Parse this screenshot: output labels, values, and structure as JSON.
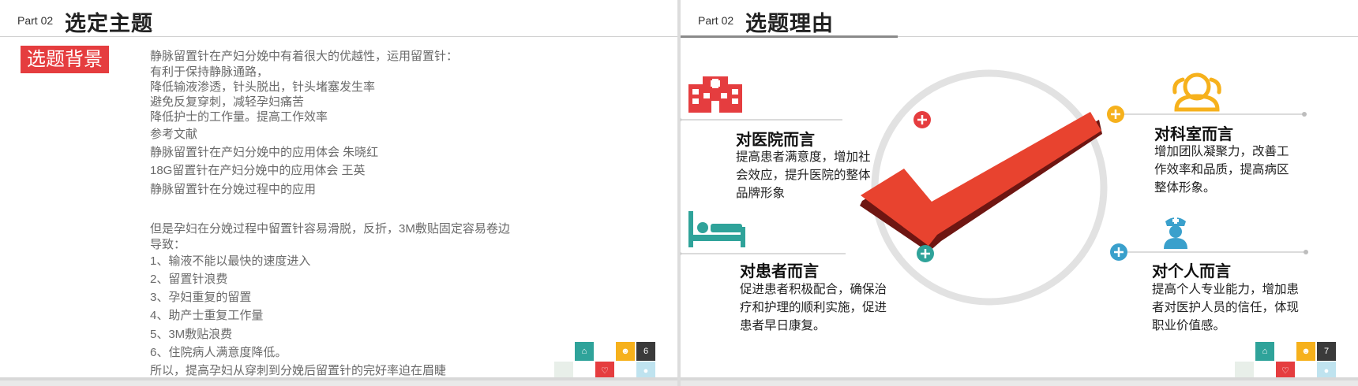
{
  "left": {
    "part": "Part 02",
    "title": "选定主题",
    "badge": "选题背景",
    "lines": [
      "静脉留置针在产妇分娩中有着很大的优越性，运用留置针：",
      "有利于保持静脉通路，",
      "降低输液渗透，针头脱出，针头堵塞发生率",
      "避免反复穿刺，减轻孕妇痛苦",
      "降低护士的工作量。提高工作效率",
      "参考文献",
      "静脉留置针在产妇分娩中的应用体会 朱晓红",
      "18G留置针在产妇分娩中的应用体会  王英",
      "静脉留置针在分娩过程中的应用",
      "但是孕妇在分娩过程中留置针容易滑脱，反折，3M敷贴固定容易卷边",
      "导致：",
      "1、输液不能以最快的速度进入",
      "2、留置针浪费",
      "3、孕妇重复的留置",
      "4、助产士重复工作量",
      "5、3M敷贴浪费",
      "6、住院病人满意度降低。",
      "所以，提高孕妇从穿刺到分娩后留置针的完好率迫在眉睫"
    ],
    "page": "6"
  },
  "right": {
    "part": "Part 02",
    "title": "选题理由",
    "hospital": {
      "head": "对医院而言",
      "desc": [
        "提高患者满意度，增加社",
        "会效应，提升医院的整体",
        "品牌形象"
      ]
    },
    "patient": {
      "head": "对患者而言",
      "desc": [
        "促进患者积极配合，确保治",
        "疗和护理的顺利实施，促进",
        "患者早日康复。"
      ]
    },
    "dept": {
      "head": "对科室而言",
      "desc": [
        "增加团队凝聚力，改善工",
        "作效率和品质，提高病区",
        "整体形象。"
      ]
    },
    "personal": {
      "head": "对个人而言",
      "desc": [
        "提高个人专业能力，增加患",
        "者对医护人员的信任，体现",
        "职业价值感。"
      ]
    },
    "page": "7"
  },
  "colors": {
    "red": "#e53d3f",
    "orange": "#f6b11c",
    "teal": "#2fa39a",
    "blue": "#3aa0cc",
    "dark": "#3a3a3a"
  },
  "icons": [
    "hospital-icon",
    "team-icon",
    "bed-icon",
    "nurse-icon",
    "check-icon",
    "plus-icon"
  ]
}
